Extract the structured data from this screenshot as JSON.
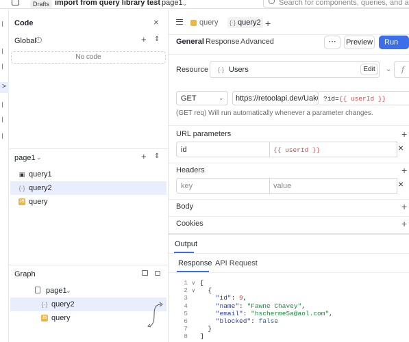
{
  "topbar": {
    "drafts": "Drafts",
    "app_name": "import from query library test",
    "separator": "/",
    "page_name": "page1",
    "search_placeholder": "Search for components, queries, and actions"
  },
  "left": {
    "code_title": "Code",
    "global_label": "Global",
    "no_code": "No code",
    "page_label": "page1",
    "queries": [
      {
        "name": "query1",
        "icon": "rest-icon"
      },
      {
        "name": "query2",
        "icon": "curly-icon",
        "selected": true
      },
      {
        "name": "query",
        "icon": "js-icon"
      }
    ],
    "graph_title": "Graph",
    "graph_page": "page1",
    "graph_items": [
      "query2",
      "query"
    ],
    "js_badge": "JS"
  },
  "editor": {
    "tabs": [
      {
        "label": "query"
      },
      {
        "label": "query2",
        "active": true
      }
    ],
    "subtabs": [
      "General",
      "Response",
      "Advanced"
    ],
    "more": "⋯",
    "preview": "Preview",
    "run": "Run",
    "run_shortcut": "⌘↵",
    "resource_label": "Resource",
    "resource_value": "Users",
    "edit": "Edit",
    "method": "GET",
    "url": "https://retoolapi.dev/Uak6u",
    "url_suffix_prefix": "?id=",
    "url_suffix_tmpl": "{{ userId }}",
    "auto_run_note": "(GET req) Will run automatically whenever a parameter changes.",
    "url_params_label": "URL parameters",
    "param_key": "id",
    "param_value": "{{ userId }}",
    "headers_label": "Headers",
    "header_key_placeholder": "key",
    "header_value_placeholder": "value",
    "body_label": "Body",
    "cookies_label": "Cookies"
  },
  "output": {
    "title": "Output",
    "tabs": [
      "Response",
      "API Request"
    ],
    "lines": [
      {
        "n": "1",
        "t": "["
      },
      {
        "n": "2",
        "t": "  {"
      },
      {
        "n": "3",
        "key": "\"id\"",
        "val": "9",
        "vt": "num"
      },
      {
        "n": "4",
        "key": "\"name\"",
        "val": "\"Fawne Chavey\"",
        "vt": "str"
      },
      {
        "n": "5",
        "key": "\"email\"",
        "val": "\"hscherme5a@aol.com\"",
        "vt": "str"
      },
      {
        "n": "6",
        "key": "\"blocked\"",
        "val": "false",
        "vt": "bool"
      },
      {
        "n": "7",
        "t": "  }"
      },
      {
        "n": "8",
        "t": "]"
      }
    ]
  }
}
